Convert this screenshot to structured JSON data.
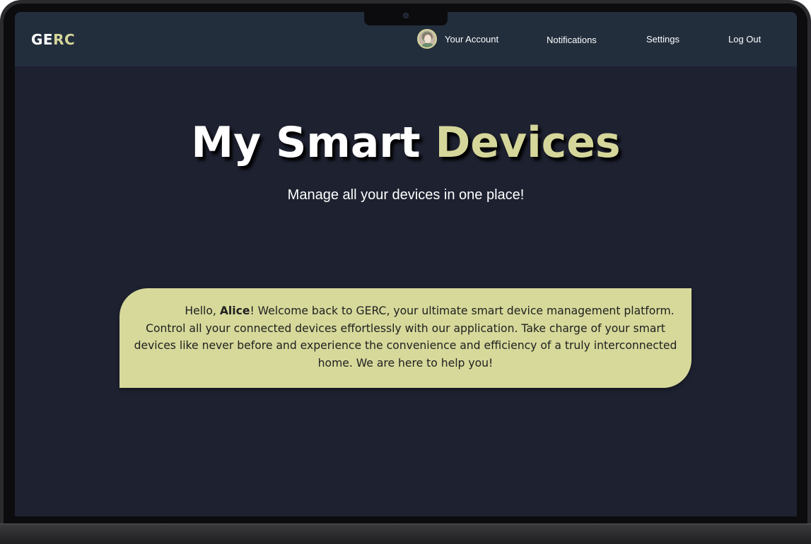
{
  "app": {
    "logo_part_a": "GE",
    "logo_part_b": "RC"
  },
  "nav": {
    "account_label": "Your Account",
    "notifications_label": "Notifications",
    "settings_label": "Settings",
    "logout_label": "Log Out"
  },
  "hero": {
    "title_part_a": "My Smart ",
    "title_part_b": "Devices",
    "subtitle": "Manage all your devices in one place!"
  },
  "welcome": {
    "greeting": "Hello, ",
    "user_name": "Alice",
    "message": "! Welcome back to GERC, your ultimate smart device management platform. Control all your connected devices effortlessly with our application. Take charge of your smart devices like never before and experience the convenience and efficiency of a truly interconnected home. We are here to help you!"
  },
  "colors": {
    "background": "#1e2130",
    "navbar": "#232e3d",
    "accent": "#d5d69a",
    "welcome_box": "#d6d99a"
  },
  "icons": {
    "avatar": "user-avatar-photo"
  }
}
